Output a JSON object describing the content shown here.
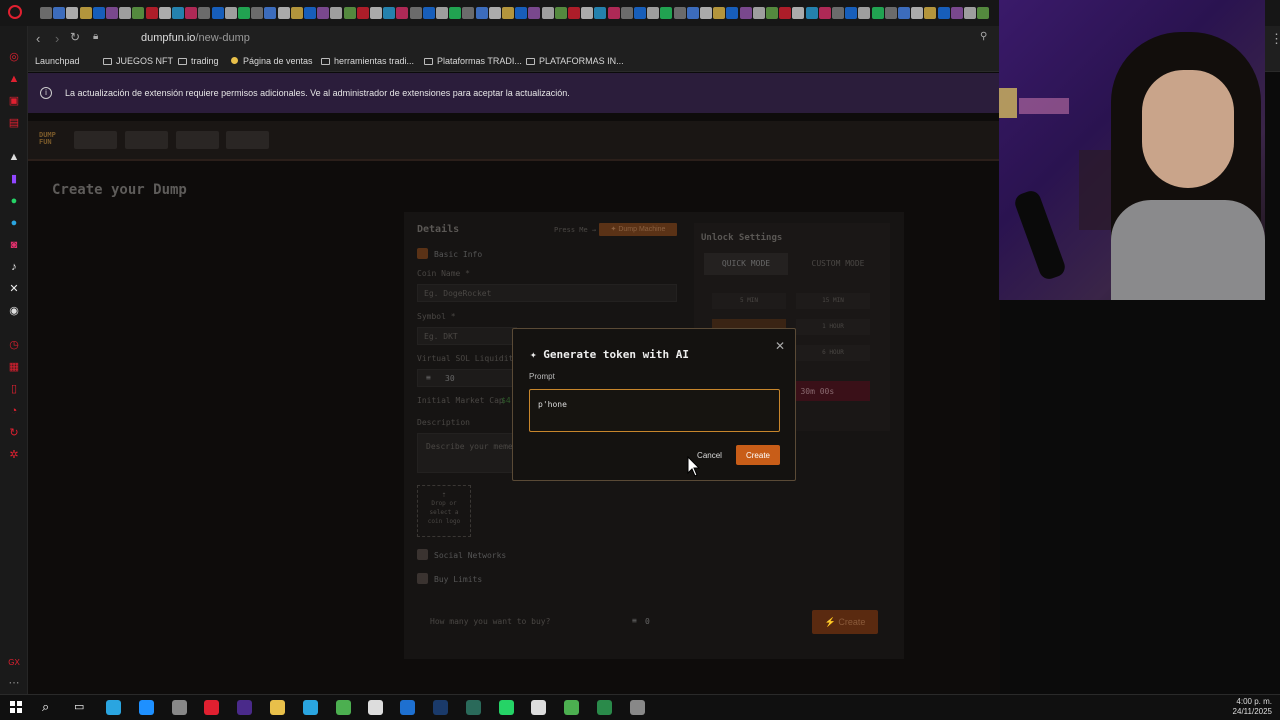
{
  "browser": {
    "url_host": "dumpfun.io",
    "url_path": "/new-dump",
    "bookmarks": [
      {
        "label": "Launchpad",
        "kind": "plain"
      },
      {
        "label": "JUEGOS NFT",
        "kind": "folder"
      },
      {
        "label": "trading",
        "kind": "folder"
      },
      {
        "label": "Página de ventas",
        "kind": "dot"
      },
      {
        "label": "herramientas tradi...",
        "kind": "folder"
      },
      {
        "label": "Plataformas TRADI...",
        "kind": "folder"
      },
      {
        "label": "PLATAFORMAS IN...",
        "kind": "folder"
      }
    ],
    "banner_text": "La actualización de extensión requiere permisos adicionales. Ve al administrador de extensiones para aceptar la actualización."
  },
  "site": {
    "logo": "DUMP FUN",
    "page_title": "Create your Dump"
  },
  "details": {
    "title": "Details",
    "press_me": "Press Me →",
    "dump_machine": "✦ Dump Machine",
    "basic_info": "Basic Info",
    "coin_name_label": "Coin Name *",
    "coin_name_placeholder": "Eg. DogeRocket",
    "symbol_label": "Symbol *",
    "symbol_placeholder": "Eg. DKT",
    "liquidity_label": "Virtual SOL Liquidity",
    "liquidity_value": "30",
    "market_cap_label": "Initial Market Cap",
    "market_cap_value": "$4",
    "description_label": "Description",
    "description_placeholder": "Describe your meme...",
    "logo_drop": "Drop or select a coin logo",
    "social_networks": "Social Networks",
    "buy_limits": "Buy Limits",
    "buy_question": "How many you want to buy?",
    "buy_value": "0",
    "create_label": "⚡ Create"
  },
  "unlock": {
    "title": "Unlock Settings",
    "quick_mode": "QUICK MODE",
    "custom_mode": "CUSTOM MODE",
    "options": [
      "5 MIN",
      "15 MIN",
      "1 HOUR",
      "6 HOUR"
    ],
    "timer": "0h 30m 00s"
  },
  "modal": {
    "title": "Generate token with AI",
    "prompt_label": "Prompt",
    "prompt_value": "p'hone",
    "cancel": "Cancel",
    "create": "Create"
  },
  "taskbar": {
    "time": "4:00 p. m.",
    "date": "24/11/2025"
  },
  "colors": {
    "accent_orange": "#c85d18",
    "banner_bg": "#2b1d3b",
    "timer_bg": "#4a1420"
  }
}
